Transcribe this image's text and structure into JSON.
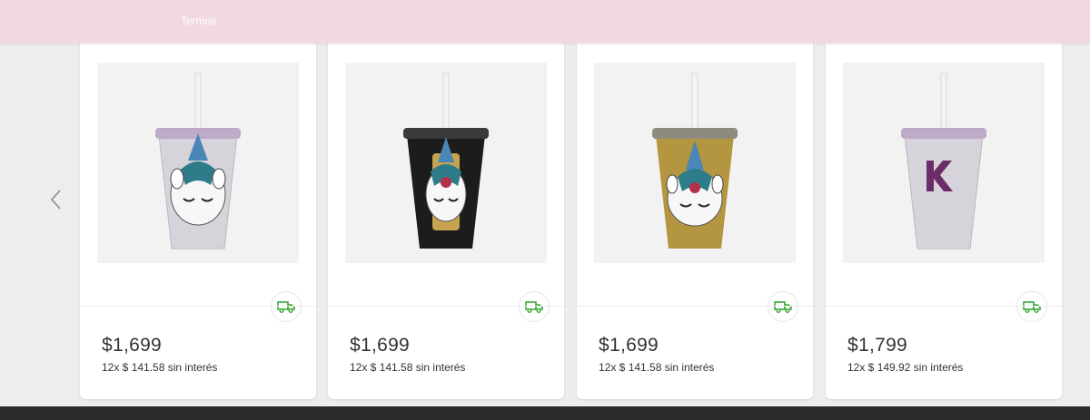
{
  "header": {
    "nav_label": "Termos"
  },
  "carousel": {
    "prev_icon": "chevron-left-icon"
  },
  "colors": {
    "header_bg": "#f2d9e1",
    "shipping_green": "#3aa935",
    "footer_bg": "#2a2a2a"
  },
  "products": [
    {
      "price": "$1,699",
      "installments": "12x $ 141.58 sin interés",
      "cup_color": "#d6d3da",
      "rim": "#bfa9c9",
      "emblem": "unicorn"
    },
    {
      "price": "$1,699",
      "installments": "12x $ 141.58 sin interés",
      "cup_color": "#1c1c1c",
      "rim": "#3a3a3a",
      "emblem": "unicorn"
    },
    {
      "price": "$1,699",
      "installments": "12x $ 141.58 sin interés",
      "cup_color": "#b3963f",
      "rim": "#8f8a80",
      "emblem": "unicorn"
    },
    {
      "price": "$1,799",
      "installments": "12x $ 149.92 sin interés",
      "cup_color": "#d6d3da",
      "rim": "#bfa9c9",
      "emblem": "K"
    }
  ]
}
